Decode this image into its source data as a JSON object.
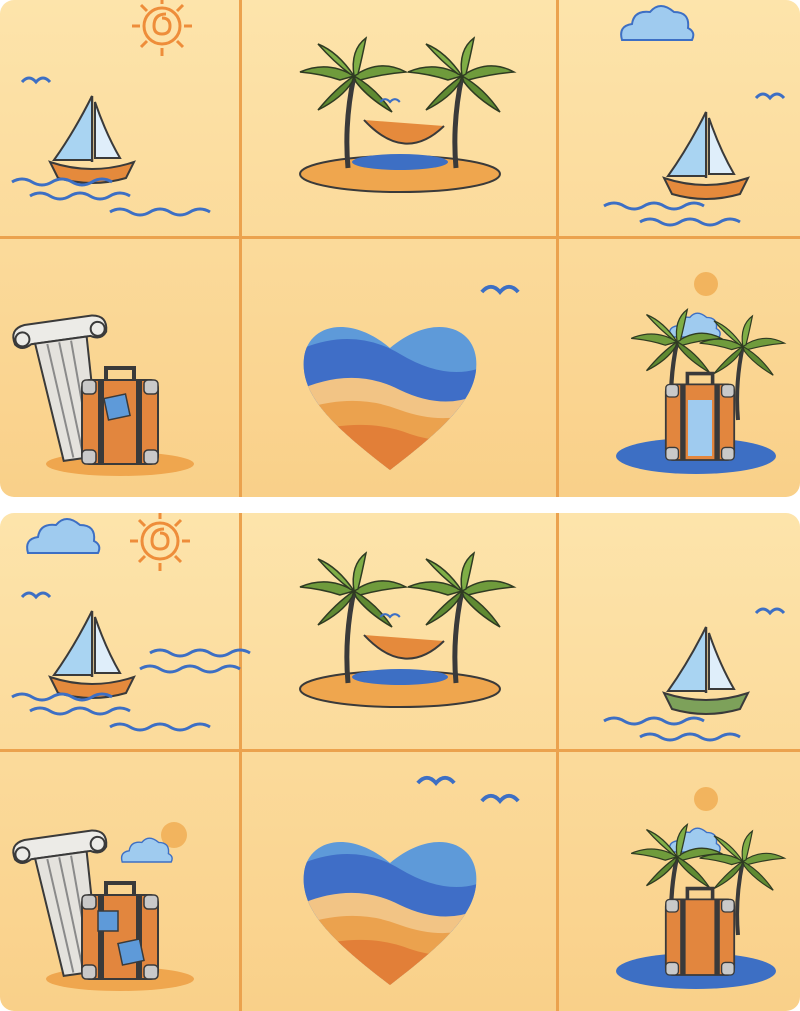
{
  "game": {
    "type": "spot-the-difference",
    "panels": [
      {
        "id": "top",
        "tiles": [
          "sailboat",
          "palm-hammock",
          "sailboat",
          "column-suitcase",
          "heart-beach",
          "palm-suitcase"
        ]
      },
      {
        "id": "bottom",
        "tiles": [
          "sailboat",
          "palm-hammock",
          "sailboat",
          "column-suitcase",
          "heart-beach",
          "palm-suitcase"
        ]
      }
    ]
  },
  "colors": {
    "background": "#fcdca0",
    "grid_line": "#eba24e",
    "boat_hull": "#e58a3c",
    "boat_hull_alt": "#7da15a",
    "sail": "#a9d4f2",
    "sea": "#3d6fc4",
    "sun": "#ee8d3a",
    "sand": "#efa64e",
    "palm": "#6f9b3c",
    "suitcase": "#e2863e",
    "column": "#e9e7e2",
    "heart_blue": "#3f6ec7",
    "heart_orange": "#e27f38"
  }
}
